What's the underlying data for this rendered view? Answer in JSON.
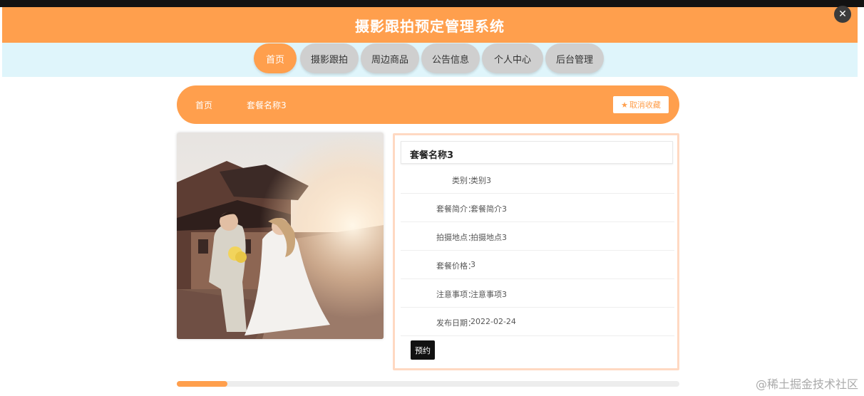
{
  "header": {
    "title": "摄影跟拍预定管理系统"
  },
  "nav": {
    "items": [
      "首页",
      "摄影跟拍",
      "周边商品",
      "公告信息",
      "个人中心",
      "后台管理"
    ],
    "active_index": 0
  },
  "breadcrumb": {
    "home": "首页",
    "current": "套餐名称3",
    "favorite_button": "取消收藏",
    "favorite_icon": "star-icon"
  },
  "detail": {
    "title": "套餐名称3",
    "fields": [
      {
        "label": "类别：",
        "value": "类别3"
      },
      {
        "label": "套餐简介：",
        "value": "套餐简介3"
      },
      {
        "label": "拍摄地点：",
        "value": "拍摄地点3"
      },
      {
        "label": "套餐价格：",
        "value": "3"
      },
      {
        "label": "注意事项：",
        "value": "注意事项3"
      },
      {
        "label": "发布日期：",
        "value": "2022-02-24"
      }
    ],
    "book_button": "预约"
  },
  "progress": {
    "fraction": 0.1
  },
  "watermark": "@稀土掘金技术社区",
  "colors": {
    "accent": "#ff9f4d",
    "nav_bg": "#dff5fb",
    "nav_inactive": "#cfcfcf"
  }
}
